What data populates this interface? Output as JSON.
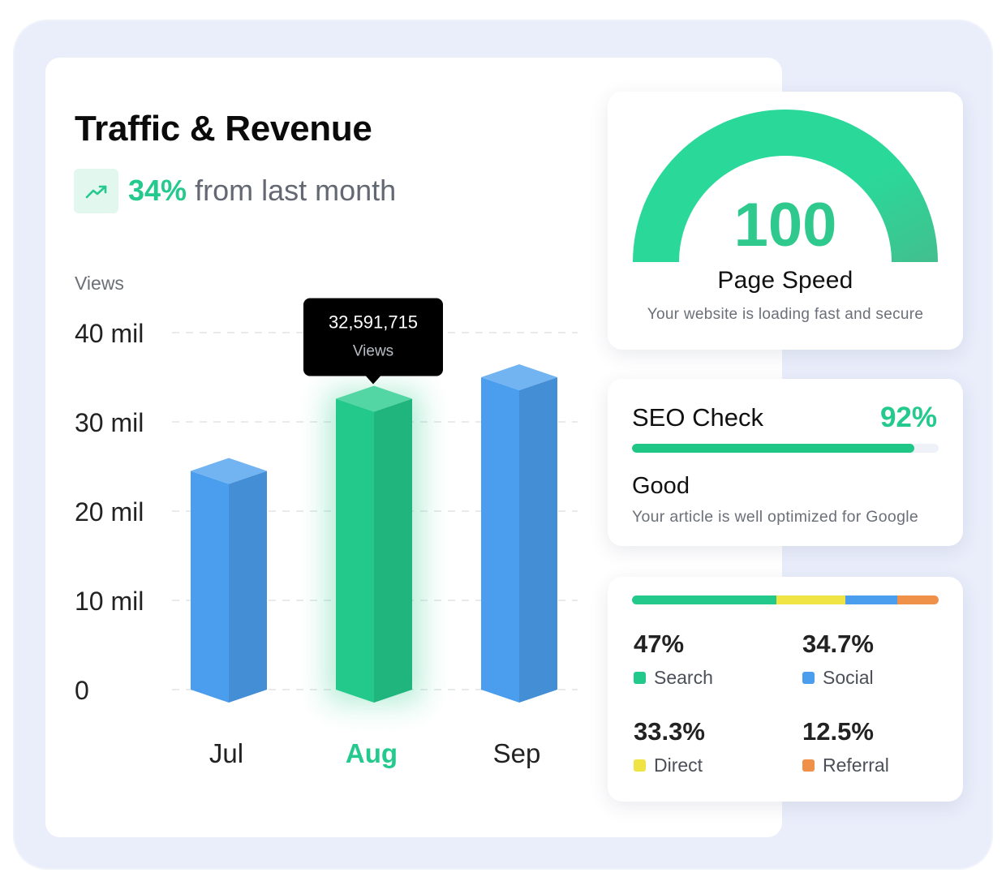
{
  "header": {
    "title": "Traffic & Revenue",
    "trend_icon": "trending-up-icon",
    "trend_percent": "34%",
    "trend_text": "from last month"
  },
  "chart_data": {
    "type": "bar",
    "ylabel": "Views",
    "categories": [
      "Jul",
      "Aug",
      "Sep"
    ],
    "values": [
      24500000,
      32591715,
      35000000
    ],
    "ylim": [
      0,
      40000000
    ],
    "yticks": [
      0,
      10000000,
      20000000,
      30000000,
      40000000
    ],
    "ytick_labels": [
      "0",
      "10 mil",
      "20 mil",
      "30 mil",
      "40 mil"
    ],
    "highlight_index": 1,
    "grid": true,
    "tooltip": {
      "value": "32,591,715",
      "label": "Views"
    },
    "colors": {
      "default": "#4a9eed",
      "highlight": "#22c98a",
      "highlight_label": "#24c98d"
    }
  },
  "page_speed": {
    "score": "100",
    "score_value": 100,
    "title": "Page Speed",
    "subtitle": "Your website is loading fast and secure",
    "color": "#2ad99a"
  },
  "seo": {
    "title": "SEO Check",
    "percent": "92%",
    "value": 92,
    "status": "Good",
    "subtitle": "Your article is well optimized for Google"
  },
  "sources": {
    "items": [
      {
        "percent": "47%",
        "label": "Search",
        "color": "#22c98a",
        "share": 47
      },
      {
        "percent": "34.7%",
        "label": "Social",
        "color": "#4a9eed",
        "share": 17
      },
      {
        "percent": "33.3%",
        "label": "Direct",
        "color": "#f0e445",
        "share": 22.5
      },
      {
        "percent": "12.5%",
        "label": "Referral",
        "color": "#f0914a",
        "share": 13.5
      }
    ]
  }
}
